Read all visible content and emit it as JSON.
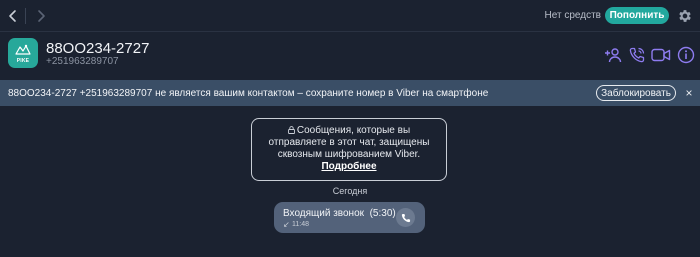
{
  "topbar": {
    "balance_text": "Нет средств",
    "topup_label": "Пополнить"
  },
  "contact": {
    "name": "88OO234-2727",
    "number": "+251963289707",
    "avatar_text": "PIKE"
  },
  "banner": {
    "text": "88OO234-2727 +251963289707 не является вашим контактом – сохраните номер в Viber на смартфоне",
    "block_label": "Заблокировать",
    "close_label": "×"
  },
  "encryption": {
    "line1": "Сообщения, которые вы",
    "line2": "отправляете в этот чат, защищены",
    "line3": "сквозным шифрованием Viber.",
    "link": "Подробнее"
  },
  "chat": {
    "date_label": "Сегодня",
    "call": {
      "title": "Входящий звонок",
      "duration": "(5:30)",
      "time": "11:48"
    }
  },
  "colors": {
    "background": "#1b2230",
    "accent_teal": "#22a89e",
    "icon_purple": "#8e7cf0",
    "banner_bg": "#3a4e66",
    "bubble_bg": "#53627a"
  },
  "icons": {
    "back": "chevron-left-icon",
    "forward": "chevron-right-icon",
    "settings": "gear-icon",
    "add_participant": "add-user-icon",
    "call": "phone-icon",
    "video": "video-camera-icon",
    "info": "info-icon",
    "lock": "lock-icon",
    "incoming": "incoming-arrow-icon"
  }
}
